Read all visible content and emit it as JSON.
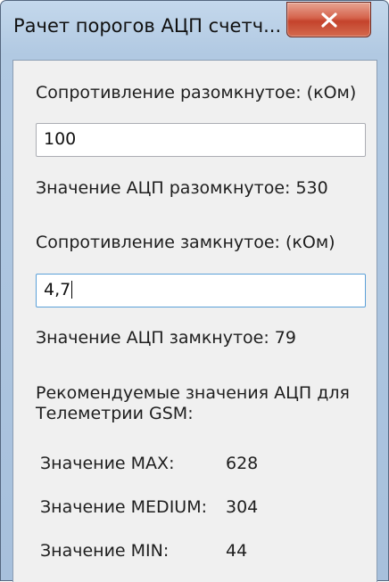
{
  "window": {
    "title": "Рачет порогов АЦП счетч..."
  },
  "open_resistance": {
    "label": "Сопротивление разомкнутое: (кОм)",
    "value": "100",
    "adc_text": "Значение АЦП разомкнутое: 530"
  },
  "closed_resistance": {
    "label": "Сопротивление замкнутое: (кОм)",
    "value": "4,7",
    "adc_text": "Значение АЦП замкнутое: 79"
  },
  "recommended": {
    "heading_line1": "Рекомендуемые значения АЦП для",
    "heading_line2": "Телеметрии GSM:",
    "rows": [
      {
        "label": "Значение MAX:",
        "value": "628"
      },
      {
        "label": "Значение MEDIUM:",
        "value": "304"
      },
      {
        "label": "Значение MIN:",
        "value": "44"
      }
    ]
  },
  "colors": {
    "frame": "#b1c9e2",
    "client_bg": "#f0f0f0",
    "close_button": "#c4432c"
  }
}
